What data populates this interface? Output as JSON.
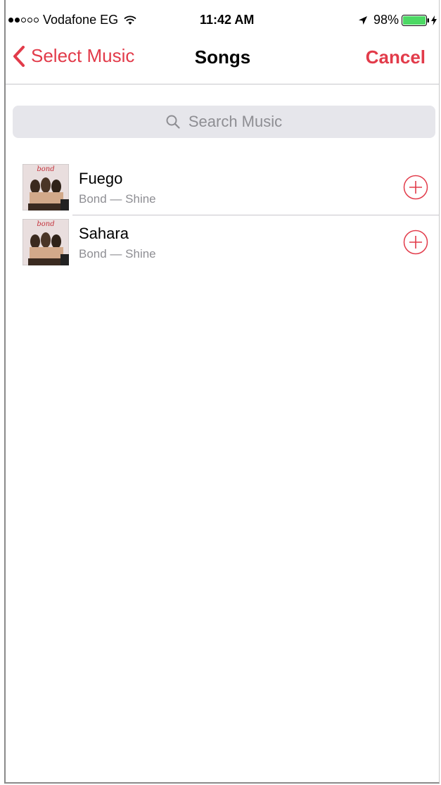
{
  "status_bar": {
    "carrier": "Vodafone EG",
    "time": "11:42 AM",
    "battery": "98%"
  },
  "nav": {
    "back_label": "Select Music",
    "title": "Songs",
    "cancel_label": "Cancel"
  },
  "search": {
    "placeholder": "Search Music"
  },
  "songs": [
    {
      "title": "Fuego",
      "subtitle": "Bond — Shine",
      "artwork_label": "bond"
    },
    {
      "title": "Sahara",
      "subtitle": "Bond — Shine",
      "artwork_label": "bond"
    }
  ],
  "colors": {
    "accent": "#e23b4a",
    "secondary_text": "#8e8e93",
    "search_bg": "#e6e6eb",
    "battery": "#4cd964"
  },
  "icons": [
    "wifi-icon",
    "location-icon",
    "battery-icon",
    "bolt-icon",
    "chevron-left-icon",
    "search-icon",
    "plus-circle-icon"
  ]
}
